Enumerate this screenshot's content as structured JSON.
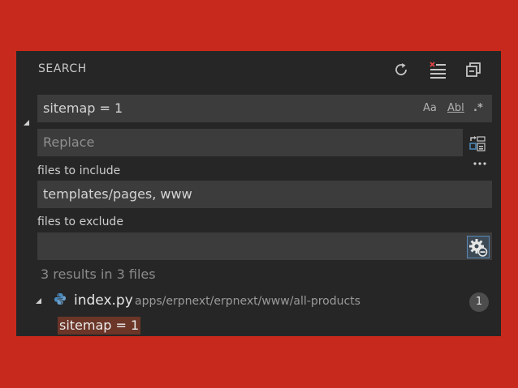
{
  "header": {
    "title": "SEARCH",
    "icons": [
      "refresh-icon",
      "clear-results-icon",
      "collapse-all-icon"
    ]
  },
  "search": {
    "value": "sitemap = 1",
    "options": {
      "match_case": "Aa",
      "whole_word": "Abl",
      "regex": ".*"
    }
  },
  "replace": {
    "placeholder": "Replace",
    "value": ""
  },
  "include": {
    "label": "files to include",
    "value": "templates/pages, www"
  },
  "exclude": {
    "label": "files to exclude",
    "value": ""
  },
  "results": {
    "summary": "3 results in 3 files",
    "files": [
      {
        "name": "index.py",
        "path": "apps/erpnext/erpnext/www/all-products",
        "count": "1",
        "match": "sitemap = 1"
      }
    ]
  },
  "colors": {
    "background": "#c72a1c",
    "panel": "#262626",
    "field": "#3c3c3c",
    "match_highlight": "#6b3528",
    "python_icon": "#4b8bbe"
  }
}
